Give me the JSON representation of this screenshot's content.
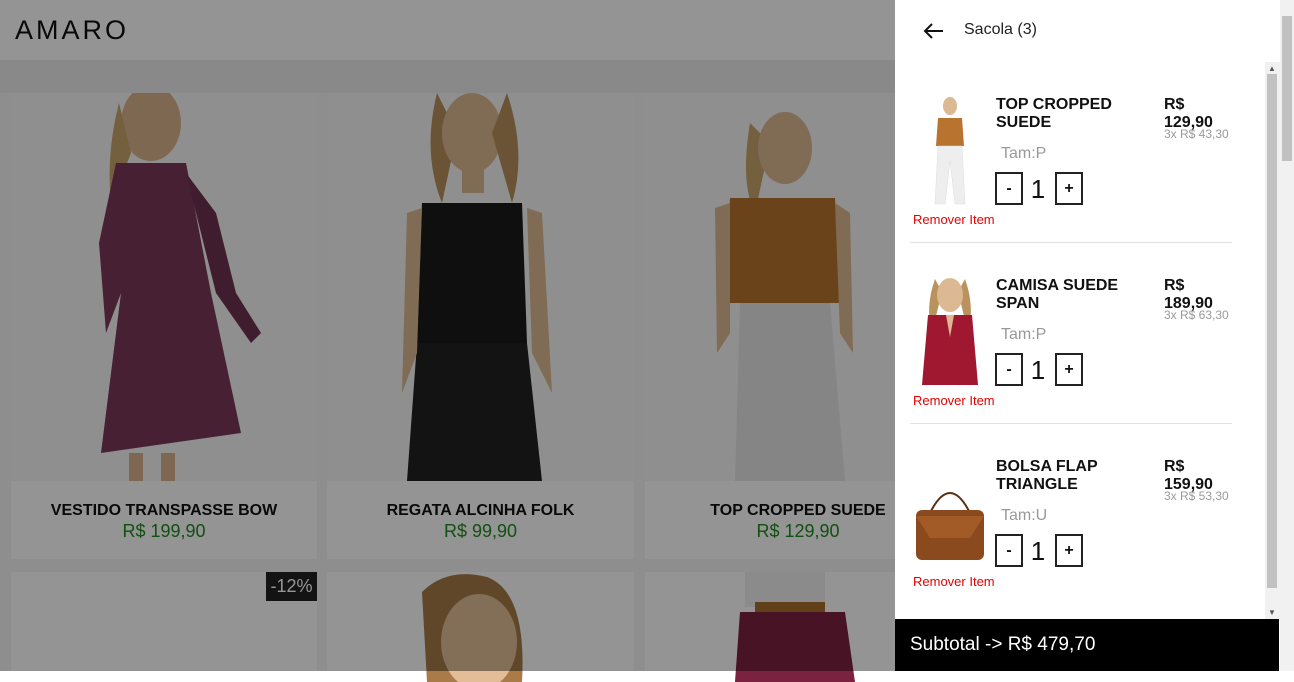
{
  "store": {
    "logo": "AMARO",
    "products": [
      {
        "name": "VESTIDO TRANSPASSE BOW",
        "price": "R$ 199,90"
      },
      {
        "name": "REGATA ALCINHA FOLK",
        "price": "R$ 99,90"
      },
      {
        "name": "TOP CROPPED SUEDE",
        "price": "R$ 129,90"
      }
    ],
    "discount_badge": "-12%"
  },
  "cart": {
    "title": "Sacola (3)",
    "items": [
      {
        "name": "TOP CROPPED SUEDE",
        "size": "Tam:P",
        "qty": "1",
        "price": "R$ 129,90",
        "installments": "3x R$ 43,30",
        "remove": "Remover Item",
        "minus": "-",
        "plus": "+"
      },
      {
        "name": "CAMISA SUEDE SPAN",
        "size": "Tam:P",
        "qty": "1",
        "price": "R$ 189,90",
        "installments": "3x R$ 63,30",
        "remove": "Remover Item",
        "minus": "-",
        "plus": "+"
      },
      {
        "name": "BOLSA FLAP TRIANGLE",
        "size": "Tam:U",
        "qty": "1",
        "price": "R$ 159,90",
        "installments": "3x R$ 53,30",
        "remove": "Remover Item",
        "minus": "-",
        "plus": "+"
      }
    ],
    "subtotal": "Subtotal -> R$ 479,70"
  },
  "colors": {
    "price_green": "#1e8a1e",
    "remove_red": "#e60000"
  }
}
